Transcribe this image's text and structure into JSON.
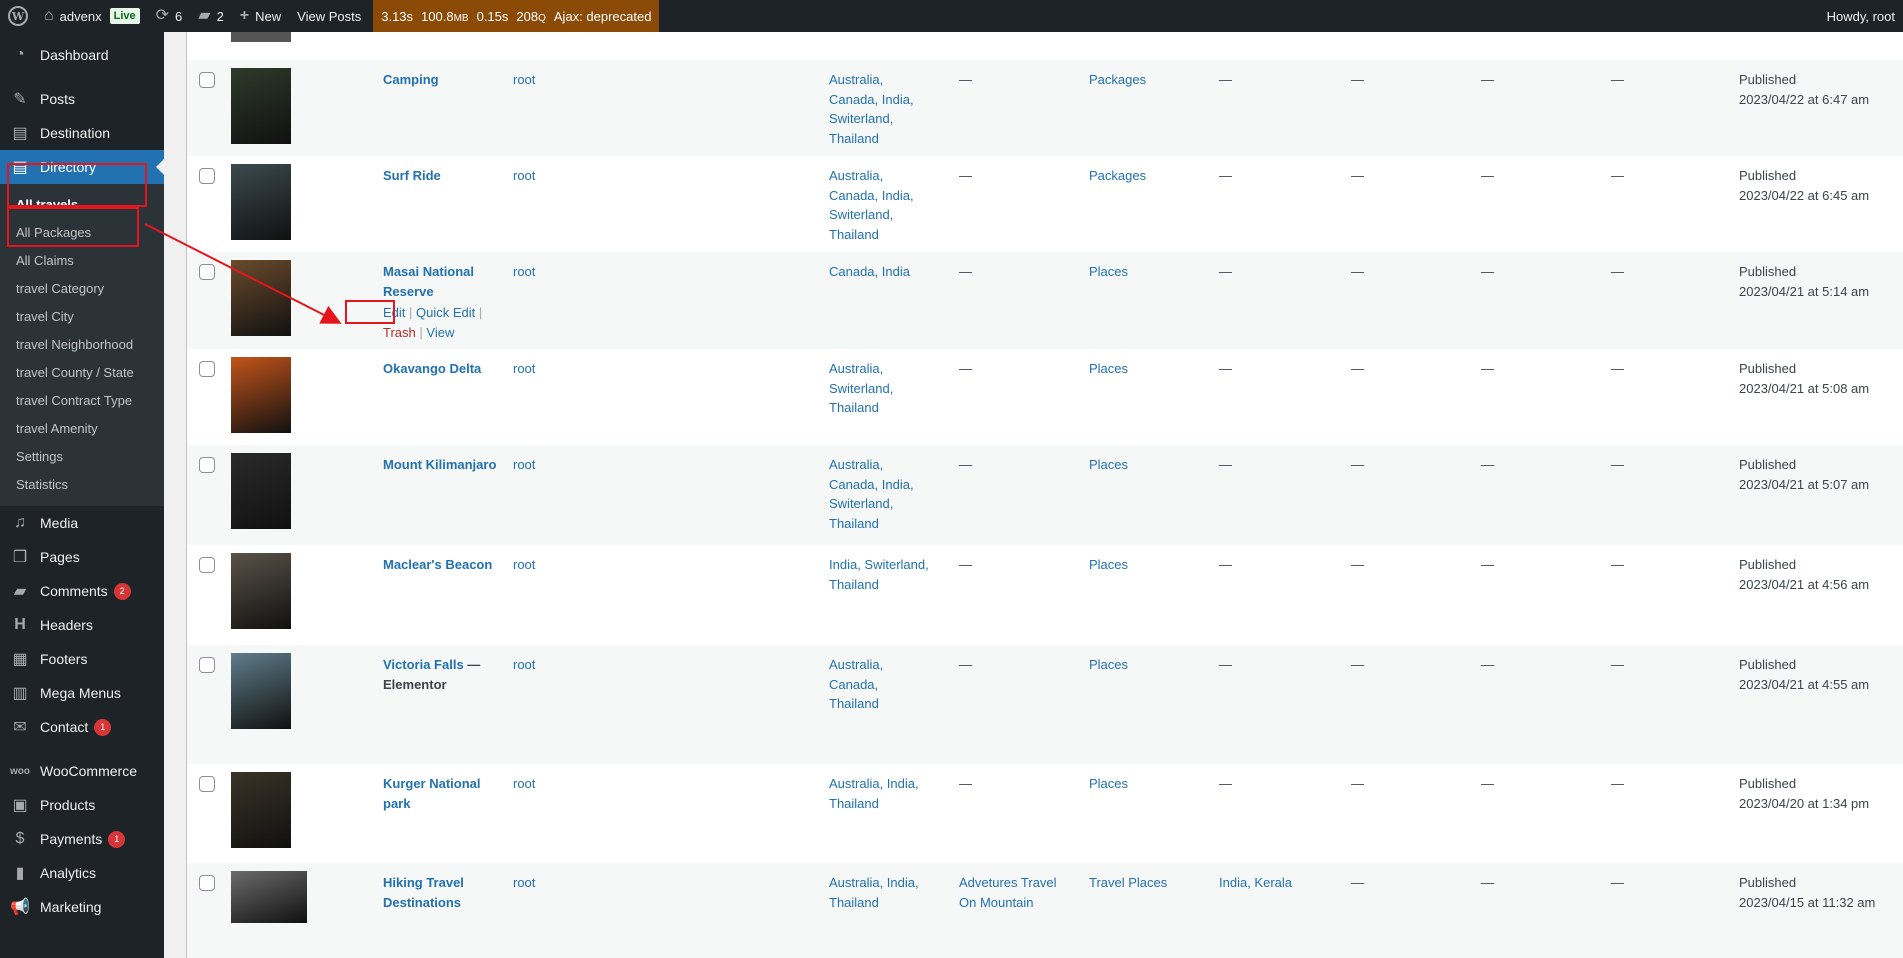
{
  "adminbar": {
    "site_name": "advenx",
    "live_label": "Live",
    "updates_count": "6",
    "comments_count": "2",
    "new_label": "New",
    "view_posts_label": "View Posts",
    "qm_time": "3.13s",
    "qm_memory": "100.8",
    "qm_memory_unit": "MB",
    "qm_db_time": "0.15s",
    "qm_queries": "208",
    "qm_queries_unit": "Q",
    "qm_ajax": "Ajax: deprecated",
    "howdy": "Howdy, root"
  },
  "sidebar": {
    "dashboard": "Dashboard",
    "posts": "Posts",
    "destination": "Destination",
    "directory": "Directory",
    "submenu": [
      "All travels",
      "All Packages",
      "All Claims",
      "travel Category",
      "travel City",
      "travel Neighborhood",
      "travel County / State",
      "travel Contract Type",
      "travel Amenity",
      "Settings",
      "Statistics"
    ],
    "media": "Media",
    "pages": "Pages",
    "comments": "Comments",
    "comments_badge": "2",
    "headers": "Headers",
    "footers": "Footers",
    "mega_menus": "Mega Menus",
    "contact": "Contact",
    "contact_badge": "1",
    "woocommerce": "WooCommerce",
    "products": "Products",
    "payments": "Payments",
    "payments_badge": "1",
    "analytics": "Analytics",
    "marketing": "Marketing"
  },
  "row_actions": {
    "edit": "Edit",
    "quick_edit": "Quick Edit",
    "trash": "Trash",
    "view": "View",
    "sep": "|"
  },
  "rows": [
    {
      "title": "Camping",
      "suffix": "",
      "author": "root",
      "locations": "Australia, Canada, India, Switerland, Thailand",
      "col5": "—",
      "category": "Packages",
      "col7": "—",
      "col8": "—",
      "col9": "—",
      "col10": "—",
      "status": "Published",
      "date": "2023/04/22 at 6:47 am"
    },
    {
      "title": "Surf Ride",
      "suffix": "",
      "author": "root",
      "locations": "Australia, Canada, India, Switerland, Thailand",
      "col5": "—",
      "category": "Packages",
      "col7": "—",
      "col8": "—",
      "col9": "—",
      "col10": "—",
      "status": "Published",
      "date": "2023/04/22 at 6:45 am"
    },
    {
      "title": "Masai National Reserve",
      "suffix": "",
      "author": "root",
      "locations": "Canada, India",
      "col5": "—",
      "category": "Places",
      "col7": "—",
      "col8": "—",
      "col9": "—",
      "col10": "—",
      "status": "Published",
      "date": "2023/04/21 at 5:14 am"
    },
    {
      "title": "Okavango Delta",
      "suffix": "",
      "author": "root",
      "locations": "Australia, Switerland, Thailand",
      "col5": "—",
      "category": "Places",
      "col7": "—",
      "col8": "—",
      "col9": "—",
      "col10": "—",
      "status": "Published",
      "date": "2023/04/21 at 5:08 am"
    },
    {
      "title": "Mount Kilimanjaro",
      "suffix": "",
      "author": "root",
      "locations": "Australia, Canada, India, Switerland, Thailand",
      "col5": "—",
      "category": "Places",
      "col7": "—",
      "col8": "—",
      "col9": "—",
      "col10": "—",
      "status": "Published",
      "date": "2023/04/21 at 5:07 am"
    },
    {
      "title": "Maclear's Beacon",
      "suffix": "",
      "author": "root",
      "locations": "India, Switerland, Thailand",
      "col5": "—",
      "category": "Places",
      "col7": "—",
      "col8": "—",
      "col9": "—",
      "col10": "—",
      "status": "Published",
      "date": "2023/04/21 at 4:56 am"
    },
    {
      "title": "Victoria Falls",
      "suffix": " — Elementor",
      "author": "root",
      "locations": "Australia, Canada, Thailand",
      "col5": "—",
      "category": "Places",
      "col7": "—",
      "col8": "—",
      "col9": "—",
      "col10": "—",
      "status": "Published",
      "date": "2023/04/21 at 4:55 am"
    },
    {
      "title": "Kurger National park",
      "suffix": "",
      "author": "root",
      "locations": "Australia, India, Thailand",
      "col5": "—",
      "category": "Places",
      "col7": "—",
      "col8": "—",
      "col9": "—",
      "col10": "—",
      "status": "Published",
      "date": "2023/04/20 at 1:34 pm"
    },
    {
      "title": "Hiking Travel Destinations",
      "suffix": "",
      "author": "root",
      "locations": "Australia, India, Thailand",
      "col5": "Advetures Travel On Mountain",
      "category": "Travel Places",
      "col7": "India, Kerala",
      "col8": "—",
      "col9": "—",
      "col10": "—",
      "status": "Published",
      "date": "2023/04/15 at 11:32 am"
    }
  ]
}
